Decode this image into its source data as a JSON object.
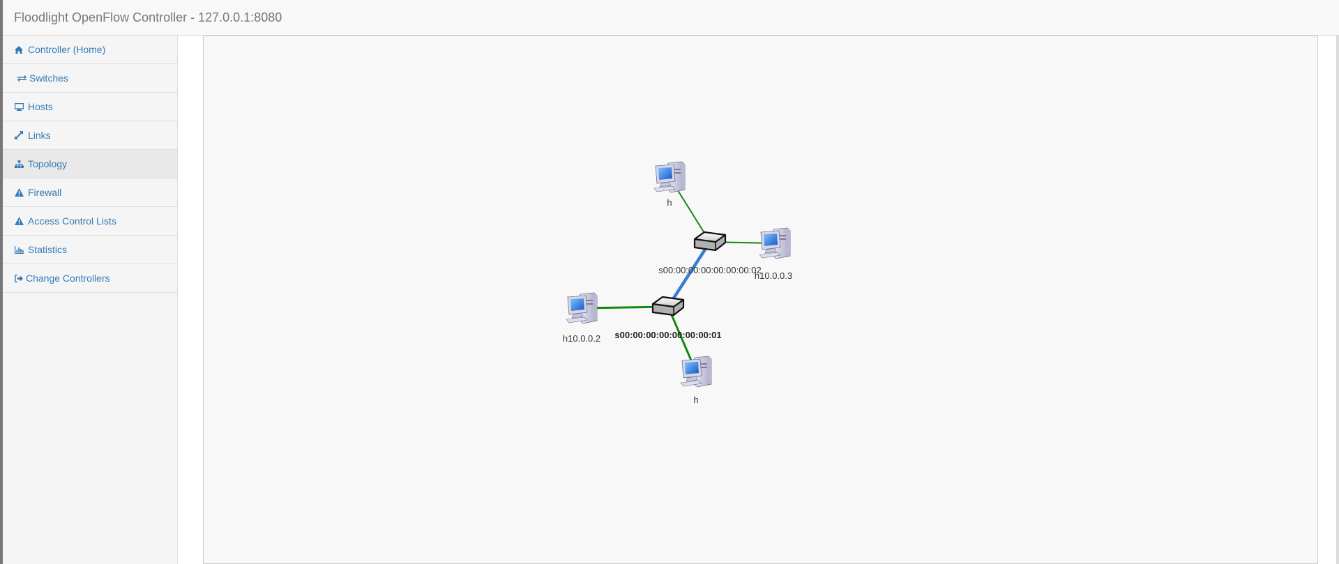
{
  "app": {
    "title": "Floodlight OpenFlow Controller - 127.0.0.1:8080"
  },
  "sidebar": {
    "items": [
      {
        "label": "Controller (Home)",
        "icon": "home-icon",
        "active": false
      },
      {
        "label": "Switches",
        "icon": "exchange-icon",
        "active": false
      },
      {
        "label": "Hosts",
        "icon": "desktop-icon",
        "active": false
      },
      {
        "label": "Links",
        "icon": "expand-icon",
        "active": false
      },
      {
        "label": "Topology",
        "icon": "sitemap-icon",
        "active": true
      },
      {
        "label": "Firewall",
        "icon": "warning-icon",
        "active": false
      },
      {
        "label": "Access Control Lists",
        "icon": "warning-icon",
        "active": false
      },
      {
        "label": "Statistics",
        "icon": "bar-chart-icon",
        "active": false
      },
      {
        "label": "Change Controllers",
        "icon": "sign-out-icon",
        "active": false
      }
    ]
  },
  "topology": {
    "switches": [
      {
        "id": "s1",
        "label": "s00:00:00:00:00:00:00:01",
        "bold": true
      },
      {
        "id": "s2",
        "label": "s00:00:00:00:00:00:00:02",
        "bold": false
      }
    ],
    "hosts": [
      {
        "id": "h1",
        "label": "h"
      },
      {
        "id": "h2",
        "label": "h10.0.0.3"
      },
      {
        "id": "h3",
        "label": "h10.0.0.2"
      },
      {
        "id": "h4",
        "label": "h"
      }
    ],
    "links": [
      {
        "from": "s1",
        "to": "s2",
        "type": "switch-link"
      },
      {
        "from": "h1",
        "to": "s2",
        "type": "host-link"
      },
      {
        "from": "h2",
        "to": "s2",
        "type": "host-link"
      },
      {
        "from": "h3",
        "to": "s1",
        "type": "host-link"
      },
      {
        "from": "h4",
        "to": "s1",
        "type": "host-link"
      }
    ],
    "colors": {
      "switch_link": "#3a7bd5",
      "host_link": "#118811"
    }
  }
}
